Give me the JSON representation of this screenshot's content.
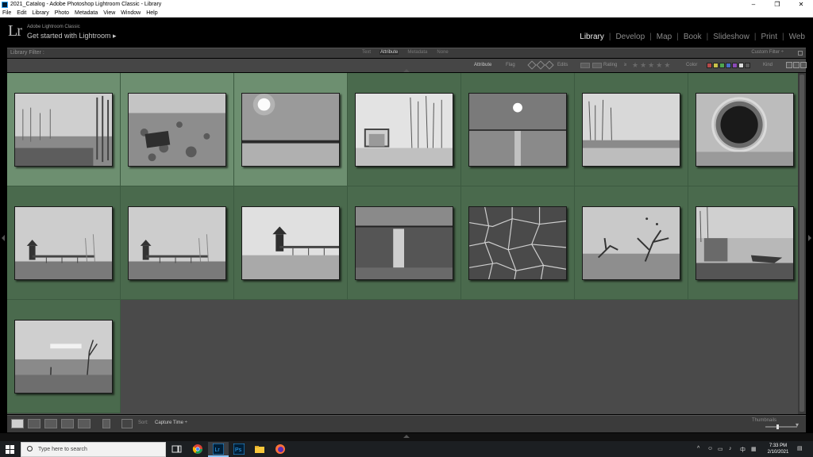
{
  "window": {
    "title": "2021_Catalog - Adobe Photoshop Lightroom Classic - Library",
    "minimize": "–",
    "maximize": "❐",
    "close": "✕"
  },
  "menu": [
    "File",
    "Edit",
    "Library",
    "Photo",
    "Metadata",
    "View",
    "Window",
    "Help"
  ],
  "identity": {
    "logo": "Lr",
    "subtitle": "Adobe Lightroom Classic",
    "get_started": "Get started with Lightroom  ▸"
  },
  "modules": [
    "Library",
    "Develop",
    "Map",
    "Book",
    "Slideshow",
    "Print",
    "Web"
  ],
  "active_module": "Library",
  "filter": {
    "label": "Library Filter :",
    "tabs": [
      "Text",
      "Attribute",
      "Metadata",
      "None"
    ],
    "active_tab": "Attribute",
    "preset": "Custom Filter ÷",
    "attribute_label": "Attribute",
    "flag_label": "Flag",
    "edits_label": "Edits",
    "rating_label": "Rating",
    "rating_op": "≥",
    "color_label": "Color",
    "kind_label": "Kind",
    "label_colors": [
      "#b54a4a",
      "#c9c24a",
      "#4fa64f",
      "#4a6ec9",
      "#8a4ab5",
      "#dcdcdc",
      "#5a5a5a"
    ]
  },
  "thumbnails": [
    {
      "scene": "fog-trees",
      "selected": true
    },
    {
      "scene": "rocky-shore",
      "selected": true
    },
    {
      "scene": "sun-horizon",
      "selected": true
    },
    {
      "scene": "structure-trees",
      "selected": false
    },
    {
      "scene": "sun-water",
      "selected": false
    },
    {
      "scene": "bare-trees-shore",
      "selected": false
    },
    {
      "scene": "pipe-tunnel",
      "selected": false
    },
    {
      "scene": "pavilion-pier",
      "selected": false
    },
    {
      "scene": "pavilion-pier",
      "selected": false
    },
    {
      "scene": "pavilion-pier-close",
      "selected": false
    },
    {
      "scene": "sun-glare-water",
      "selected": false
    },
    {
      "scene": "cracked-earth",
      "selected": false
    },
    {
      "scene": "driftwood",
      "selected": false
    },
    {
      "scene": "boat-shore",
      "selected": false
    },
    {
      "scene": "dead-branch-shore",
      "selected": false
    }
  ],
  "toolbar": {
    "sort_label": "Sort:",
    "sort_value": "Capture Time ÷",
    "thumbnails_label": "Thumbnails"
  },
  "taskbar": {
    "search_placeholder": "Type here to search",
    "time": "7:33 PM",
    "date": "2/10/2021"
  }
}
